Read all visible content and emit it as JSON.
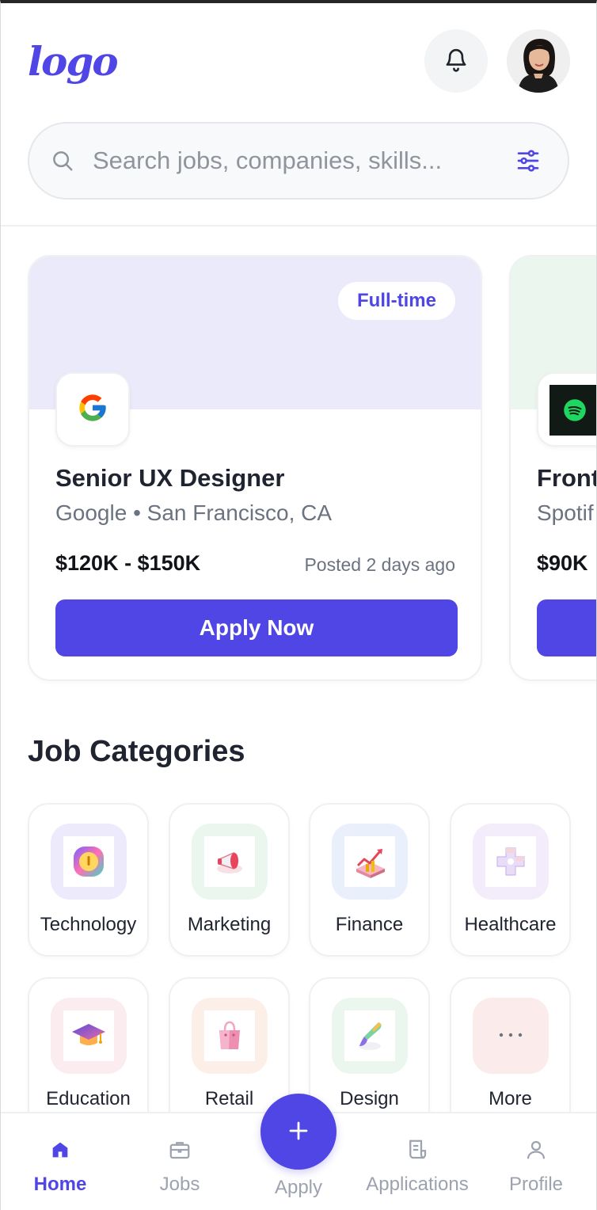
{
  "header": {
    "logo_text": "logo",
    "notifications_icon": "bell-icon",
    "avatar_alt": "user avatar"
  },
  "search": {
    "placeholder": "Search jobs, companies, skills...",
    "search_icon": "search-icon",
    "filter_icon": "sliders-icon"
  },
  "jobs": [
    {
      "type_tag": "Full-time",
      "company_logo": "google-logo",
      "title": "Senior UX Designer",
      "company_location": "Google • San Francisco, CA",
      "salary": "$120K - $150K",
      "posted": "Posted 2 days ago",
      "apply_label": "Apply Now",
      "banner_color": "#ebeafa"
    },
    {
      "company_logo": "spotify-logo",
      "title": "Front",
      "company_location": "Spotif",
      "salary": "$90K",
      "banner_color": "#eaf6ee"
    }
  ],
  "categories": {
    "title": "Job Categories",
    "items": [
      {
        "label": "Technology",
        "icon": "technology-icon",
        "bg": "#eceafb"
      },
      {
        "label": "Marketing",
        "icon": "megaphone-icon",
        "bg": "#eaf6ee"
      },
      {
        "label": "Finance",
        "icon": "chart-up-icon",
        "bg": "#eaf0fb"
      },
      {
        "label": "Healthcare",
        "icon": "medical-cross-icon",
        "bg": "#f2ecfb"
      },
      {
        "label": "Education",
        "icon": "graduation-cap-icon",
        "bg": "#fbecef"
      },
      {
        "label": "Retail",
        "icon": "shopping-bag-icon",
        "bg": "#fbefe8"
      },
      {
        "label": "Design",
        "icon": "paintbrush-icon",
        "bg": "#eaf6ee"
      },
      {
        "label": "More",
        "icon": "more-dots-icon",
        "bg": "#fbeceb"
      }
    ]
  },
  "nav": {
    "items": [
      {
        "label": "Home",
        "icon": "home-icon",
        "active": true
      },
      {
        "label": "Jobs",
        "icon": "briefcase-icon",
        "active": false
      },
      {
        "label": "Apply",
        "icon": "plus-icon",
        "active": false
      },
      {
        "label": "Applications",
        "icon": "document-icon",
        "active": false
      },
      {
        "label": "Profile",
        "icon": "user-icon",
        "active": false
      }
    ]
  },
  "colors": {
    "accent": "#4f46e5",
    "text": "#1f2430",
    "muted": "#6b7280"
  }
}
